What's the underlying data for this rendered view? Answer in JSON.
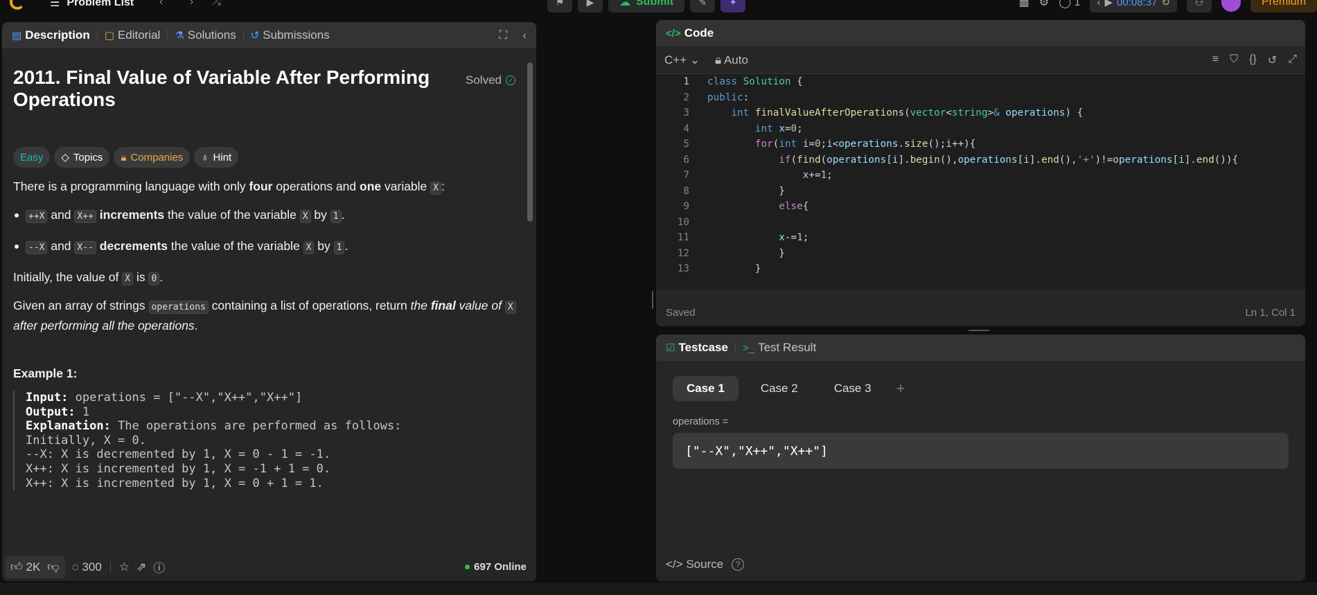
{
  "topbar": {
    "title": "Problem List",
    "submit_label": "Submit",
    "streak": "1",
    "timer": "00:08:37",
    "premium_label": "Premium"
  },
  "description_panel": {
    "tabs": [
      {
        "label": "Description"
      },
      {
        "label": "Editorial"
      },
      {
        "label": "Solutions"
      },
      {
        "label": "Submissions"
      }
    ],
    "problem_title": "2011. Final Value of Variable After Performing Operations",
    "status": "Solved",
    "chips": {
      "difficulty": "Easy",
      "topics": "Topics",
      "companies": "Companies",
      "hint": "Hint"
    },
    "intro": {
      "pre": "There is a programming language with only ",
      "b1": "four",
      "mid": " operations and ",
      "b2": "one",
      "post": " variable ",
      "var": "X",
      "end": ":"
    },
    "bullets": [
      {
        "c1": "++X",
        "and": " and ",
        "c2": "X++",
        "verb": "increments",
        "rest": " the value of the variable ",
        "c3": "X",
        "by": " by ",
        "c4": "1",
        "end": "."
      },
      {
        "c1": "--X",
        "and": " and ",
        "c2": "X--",
        "verb": "decrements",
        "rest": " the value of the variable ",
        "c3": "X",
        "by": " by ",
        "c4": "1",
        "end": "."
      }
    ],
    "initially": {
      "pre": "Initially, the value of ",
      "var": "X",
      "is": " is ",
      "val": "0",
      "end": "."
    },
    "given": {
      "pre": "Given an array of strings ",
      "code": "operations",
      "mid": " containing a list of operations, return ",
      "i1": "the ",
      "b": "final",
      "i2": " value of ",
      "var": "X",
      "i3": " after performing all the operations",
      "end": "."
    },
    "example_title": "Example 1:",
    "example": {
      "input_label": "Input:",
      "input": " operations = [\"--X\",\"X++\",\"X++\"]",
      "output_label": "Output:",
      "output": " 1",
      "explanation_label": "Explanation:",
      "explanation": " The operations are performed as follows:",
      "lines": [
        "Initially, X = 0.",
        "--X: X is decremented by 1, X =  0 - 1 = -1.",
        "X++: X is incremented by 1, X = -1 + 1 =  0.",
        "X++: X is incremented by 1, X =  0 + 1 =  1."
      ]
    },
    "footer": {
      "likes": "2K",
      "comments": "300",
      "online": "697 Online"
    }
  },
  "code_panel": {
    "title": "Code",
    "language": "C++",
    "mode": "Auto",
    "status": "Saved",
    "cursor": "Ln 1, Col 1"
  },
  "test_panel": {
    "tabs": [
      {
        "label": "Testcase"
      },
      {
        "label": "Test Result"
      }
    ],
    "cases": [
      "Case 1",
      "Case 2",
      "Case 3"
    ],
    "param_label": "operations =",
    "param_value": "[\"--X\",\"X++\",\"X++\"]",
    "source_label": "Source"
  }
}
